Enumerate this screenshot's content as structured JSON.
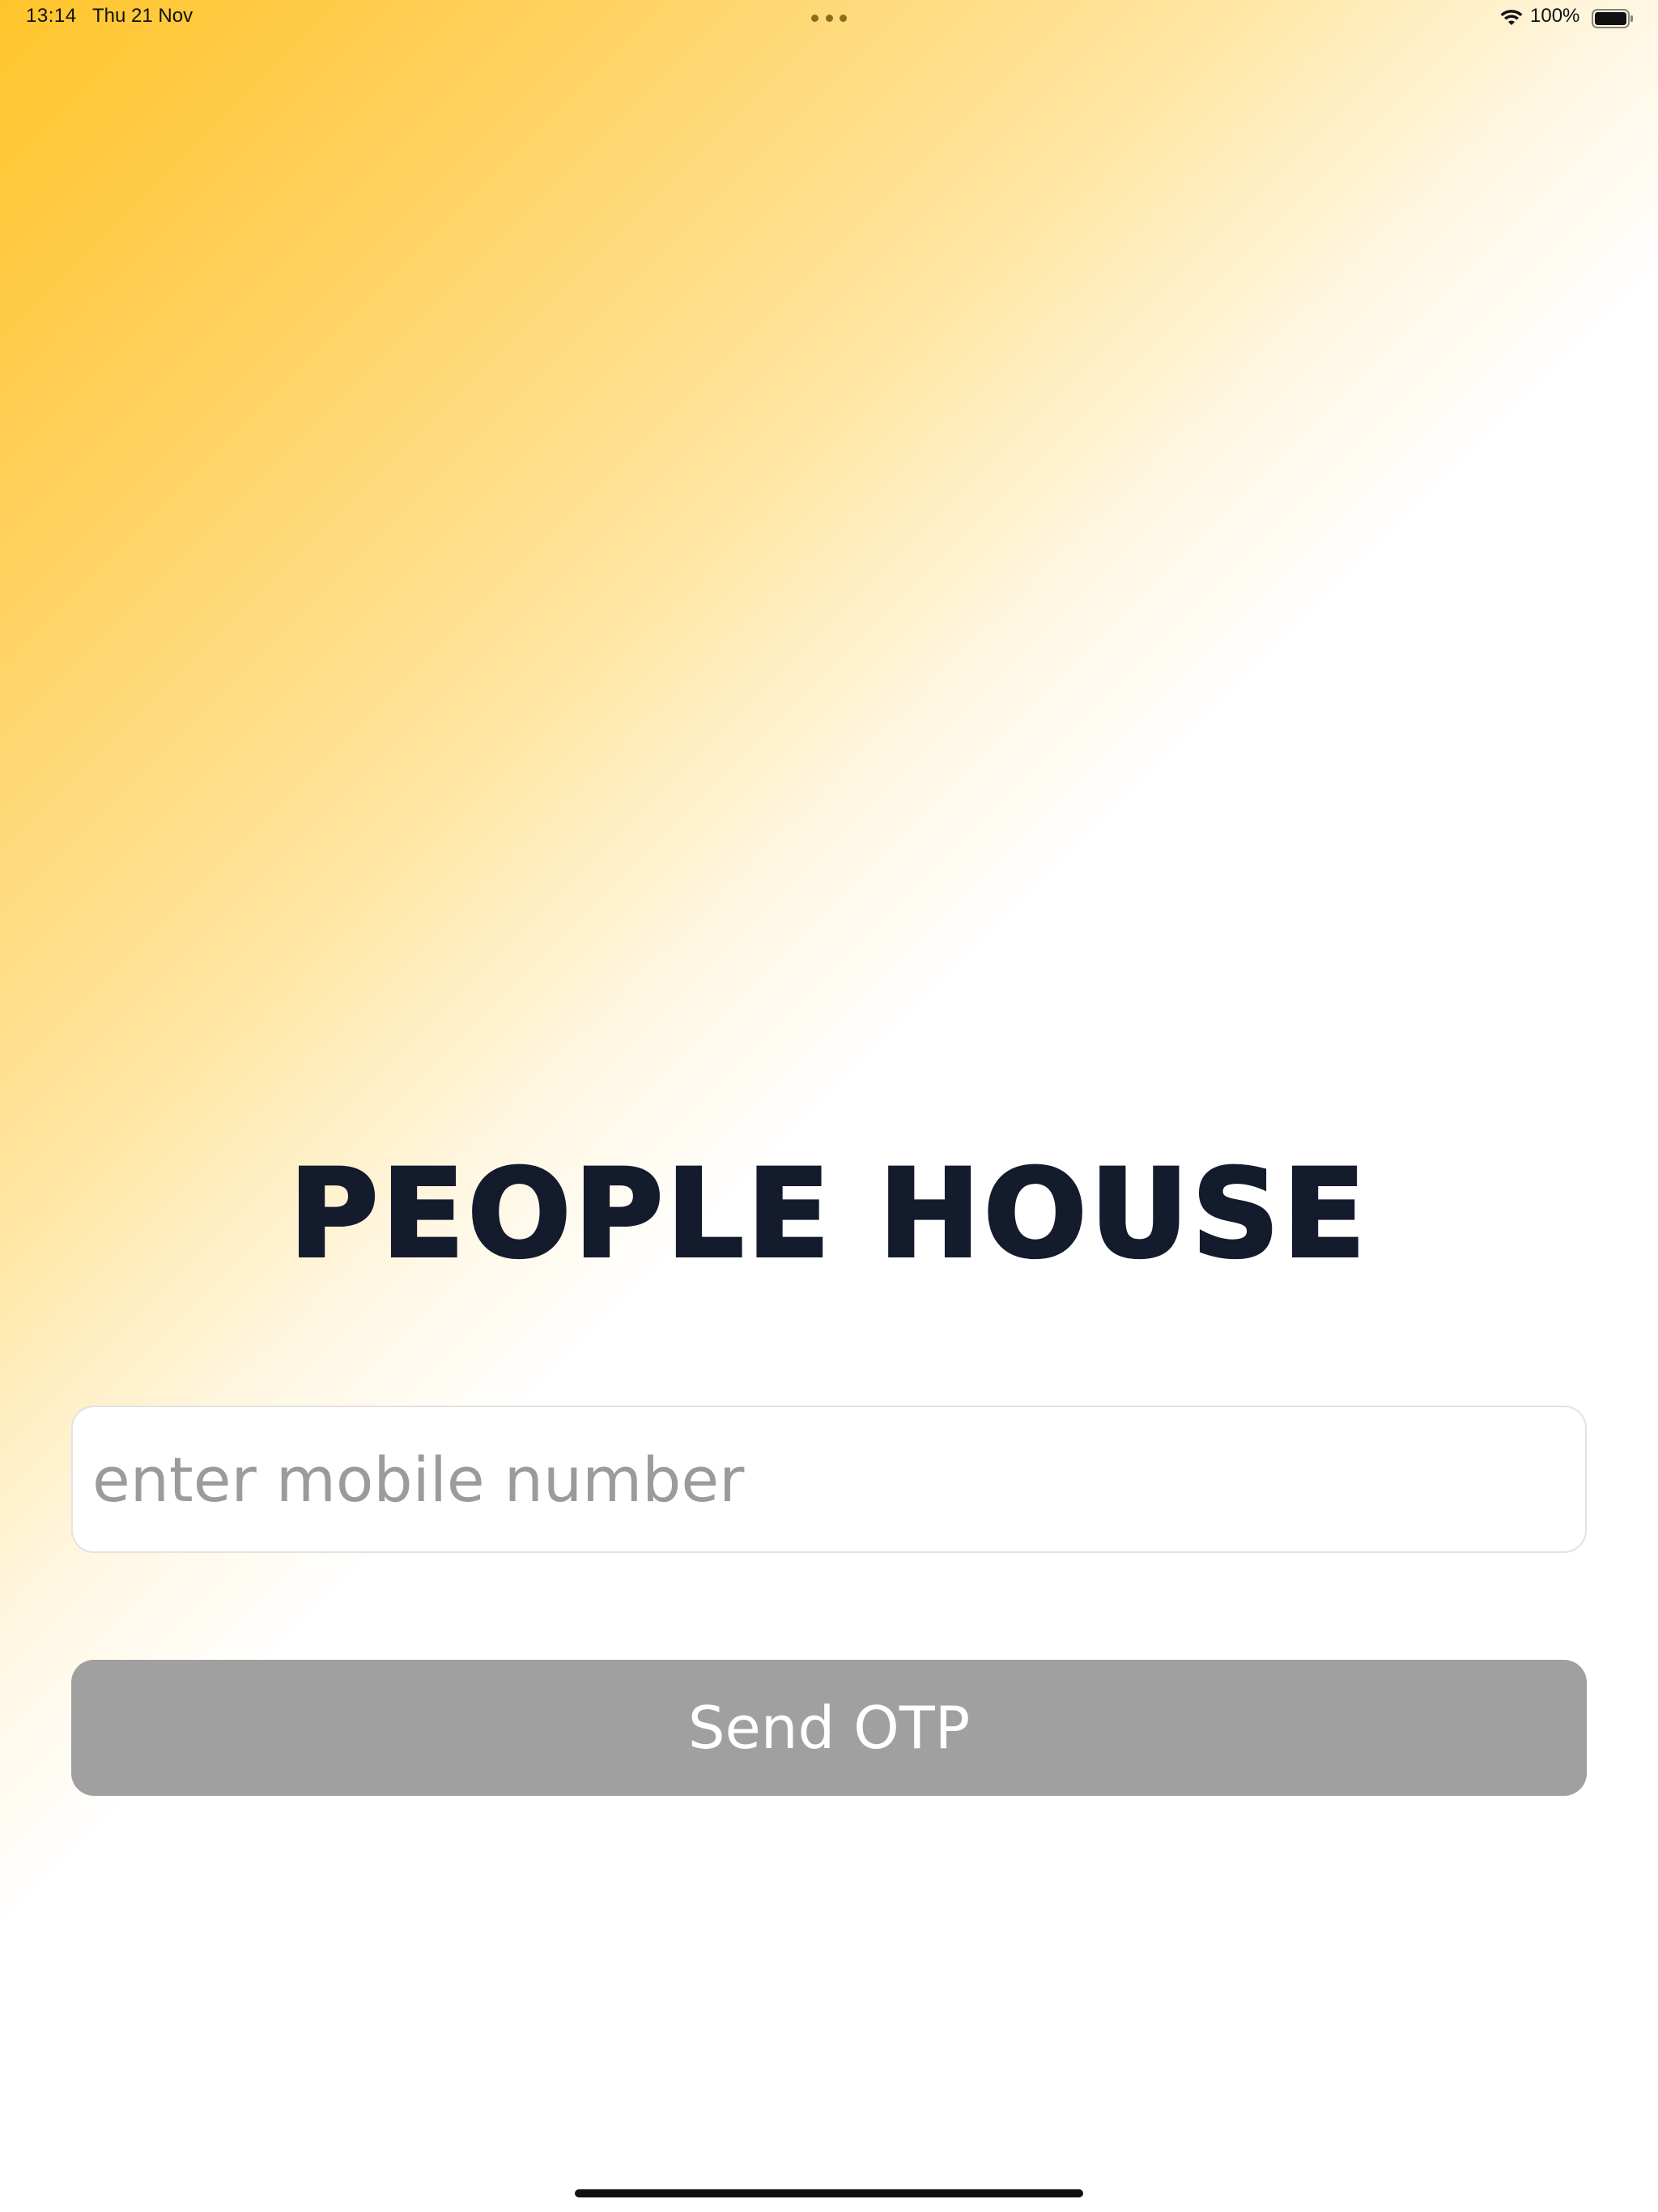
{
  "status_bar": {
    "time": "13:14",
    "date": "Thu 21 Nov",
    "battery": "100%",
    "icons": [
      "wifi-icon",
      "battery-icon",
      "multitask-dots-icon"
    ]
  },
  "app": {
    "title": "PEOPLE HOUSE"
  },
  "login": {
    "mobile_placeholder": "enter mobile number",
    "mobile_value": "",
    "send_label": "Send OTP"
  },
  "colors": {
    "gradient_start": "#ffc52b",
    "title": "#141b2d",
    "button_disabled": "#a0a0a0",
    "button_text": "#ffffff",
    "placeholder": "#9b9b9b"
  }
}
